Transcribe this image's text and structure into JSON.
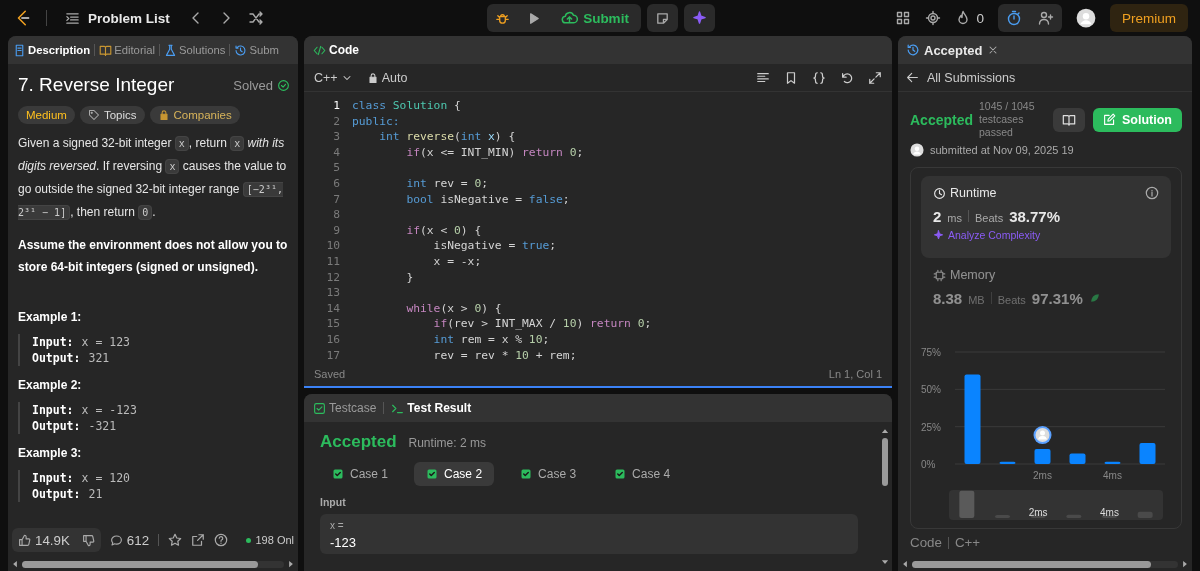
{
  "top_bar": {
    "title": "Problem List",
    "submit": "Submit",
    "streak": "0",
    "premium": "Premium"
  },
  "left_panel": {
    "tabs": [
      {
        "label": "Description",
        "kind": "description",
        "selected": true
      },
      {
        "label": "Editorial",
        "kind": "editorial",
        "selected": false
      },
      {
        "label": "Solutions",
        "kind": "solutions",
        "selected": false
      },
      {
        "label": "Subm",
        "kind": "submissions",
        "selected": false
      }
    ],
    "title": "7. Reverse Integer",
    "status": "Solved",
    "tags": [
      {
        "label": "Medium",
        "kind": "difficulty"
      },
      {
        "label": "Topics",
        "kind": "topics"
      },
      {
        "label": "Companies",
        "kind": "companies"
      }
    ],
    "description": [
      {
        "kind": "text",
        "text": "Given a signed 32-bit integer "
      },
      {
        "kind": "code",
        "text": "x"
      },
      {
        "kind": "text",
        "text": ", return "
      },
      {
        "kind": "code",
        "text": "x"
      },
      {
        "kind": "italic",
        "text": " with its digits reversed"
      },
      {
        "kind": "text",
        "text": ". If reversing "
      },
      {
        "kind": "code",
        "text": "x"
      },
      {
        "kind": "text",
        "text": " causes the value to go outside the signed 32-bit integer range "
      },
      {
        "kind": "code",
        "text": "[−2³¹, 2³¹ − 1]"
      },
      {
        "kind": "text",
        "text": ", then return "
      },
      {
        "kind": "code",
        "text": "0"
      },
      {
        "kind": "text",
        "text": "."
      }
    ],
    "note": "Assume the environment does not allow you to store 64-bit integers (signed or unsigned).",
    "examples": [
      {
        "title": "Example 1:",
        "input_label": "Input:",
        "input": "x = 123",
        "output_label": "Output:",
        "output": "321"
      },
      {
        "title": "Example 2:",
        "input_label": "Input:",
        "input": "x = -123",
        "output_label": "Output:",
        "output": "-321"
      },
      {
        "title": "Example 3:",
        "input_label": "Input:",
        "input": "x = 120",
        "output_label": "Output:",
        "output": "21"
      }
    ],
    "footer": {
      "likes": "14.9K",
      "comments": "612",
      "online": "198 Onl"
    }
  },
  "code_panel": {
    "title": "Code",
    "language": "C++",
    "mode": "Auto",
    "lines": [
      {
        "number": "1",
        "current": true,
        "tokens": [
          {
            "kind": "type",
            "text": "class"
          },
          {
            "kind": "cls",
            "text": " Solution"
          },
          {
            "kind": "plain",
            "text": " {"
          }
        ]
      },
      {
        "number": "2",
        "current": false,
        "tokens": [
          {
            "kind": "type",
            "text": "public:"
          }
        ]
      },
      {
        "number": "3",
        "current": false,
        "tokens": [
          {
            "kind": "type",
            "text": "    int"
          },
          {
            "kind": "fn",
            "text": " reverse"
          },
          {
            "kind": "plain",
            "text": "("
          },
          {
            "kind": "type",
            "text": "int"
          },
          {
            "kind": "var",
            "text": " x"
          },
          {
            "kind": "plain",
            "text": ") {"
          }
        ]
      },
      {
        "number": "4",
        "current": false,
        "tokens": [
          {
            "kind": "ctrl",
            "text": "        if"
          },
          {
            "kind": "plain",
            "text": "(x <= INT_MIN) "
          },
          {
            "kind": "ctrl",
            "text": "return"
          },
          {
            "kind": "num",
            "text": " 0"
          },
          {
            "kind": "plain",
            "text": ";"
          }
        ]
      },
      {
        "number": "5",
        "current": false
      },
      {
        "number": "6",
        "current": false,
        "tokens": [
          {
            "kind": "type",
            "text": "        int"
          },
          {
            "kind": "plain",
            "text": " rev = "
          },
          {
            "kind": "num",
            "text": "0"
          },
          {
            "kind": "plain",
            "text": ";"
          }
        ]
      },
      {
        "number": "7",
        "current": false,
        "tokens": [
          {
            "kind": "type",
            "text": "        bool"
          },
          {
            "kind": "plain",
            "text": " isNegative = "
          },
          {
            "kind": "type",
            "text": "false"
          },
          {
            "kind": "plain",
            "text": ";"
          }
        ]
      },
      {
        "number": "8",
        "current": false
      },
      {
        "number": "9",
        "current": false,
        "tokens": [
          {
            "kind": "ctrl",
            "text": "        if"
          },
          {
            "kind": "plain",
            "text": "(x < "
          },
          {
            "kind": "num",
            "text": "0"
          },
          {
            "kind": "plain",
            "text": ") {"
          }
        ]
      },
      {
        "number": "10",
        "current": false,
        "tokens": [
          {
            "kind": "plain",
            "text": "            isNegative = "
          },
          {
            "kind": "type",
            "text": "true"
          },
          {
            "kind": "plain",
            "text": ";"
          }
        ]
      },
      {
        "number": "11",
        "current": false,
        "tokens": [
          {
            "kind": "plain",
            "text": "            x = -x;"
          }
        ]
      },
      {
        "number": "12",
        "current": false,
        "tokens": [
          {
            "kind": "plain",
            "text": "        }"
          }
        ]
      },
      {
        "number": "13",
        "current": false
      },
      {
        "number": "14",
        "current": false,
        "tokens": [
          {
            "kind": "ctrl",
            "text": "        while"
          },
          {
            "kind": "plain",
            "text": "(x > "
          },
          {
            "kind": "num",
            "text": "0"
          },
          {
            "kind": "plain",
            "text": ") {"
          }
        ]
      },
      {
        "number": "15",
        "current": false,
        "tokens": [
          {
            "kind": "ctrl",
            "text": "            if"
          },
          {
            "kind": "plain",
            "text": "(rev > INT_MAX / "
          },
          {
            "kind": "num",
            "text": "10"
          },
          {
            "kind": "plain",
            "text": ") "
          },
          {
            "kind": "ctrl",
            "text": "return"
          },
          {
            "kind": "num",
            "text": " 0"
          },
          {
            "kind": "plain",
            "text": ";"
          }
        ]
      },
      {
        "number": "16",
        "current": false,
        "tokens": [
          {
            "kind": "type",
            "text": "            int"
          },
          {
            "kind": "plain",
            "text": " rem = x % "
          },
          {
            "kind": "num",
            "text": "10"
          },
          {
            "kind": "plain",
            "text": ";"
          }
        ]
      },
      {
        "number": "17",
        "current": false,
        "tokens": [
          {
            "kind": "plain",
            "text": "            rev = rev * "
          },
          {
            "kind": "num",
            "text": "10"
          },
          {
            "kind": "plain",
            "text": " + rem;"
          }
        ]
      }
    ],
    "status": "Saved",
    "cursor": "Ln 1, Col 1"
  },
  "test_panel": {
    "tabs": [
      {
        "label": "Testcase",
        "kind": "testcase",
        "selected": false
      },
      {
        "label": "Test Result",
        "kind": "result",
        "selected": true
      }
    ],
    "verdict": "Accepted",
    "runtime": "Runtime: 2 ms",
    "cases": [
      {
        "label": "Case 1",
        "passed": true,
        "selected": false
      },
      {
        "label": "Case 2",
        "passed": true,
        "selected": true
      },
      {
        "label": "Case 3",
        "passed": true,
        "selected": false
      },
      {
        "label": "Case 4",
        "passed": true,
        "selected": false
      }
    ],
    "input_label": "Input",
    "variable": "x =",
    "value": "-123"
  },
  "right_panel": {
    "tab": "Accepted",
    "back": "All Submissions",
    "status": "Accepted",
    "passed": "1045 / 1045",
    "passed_label": "testcases passed",
    "submitted": "submitted at Nov 09, 2025 19",
    "solution_button": "Solution",
    "metrics": [
      {
        "kind": "runtime",
        "label": "Runtime",
        "value": "2",
        "unit": "ms",
        "beats_label": "Beats",
        "beats": "38.77%",
        "link": "Analyze Complexity",
        "selected": true
      },
      {
        "kind": "memory",
        "label": "Memory",
        "value": "8.38",
        "unit": "MB",
        "beats_label": "Beats",
        "beats": "97.31%",
        "selected": false
      }
    ],
    "chart_data": {
      "type": "bar",
      "categories": [
        null,
        null,
        "2ms",
        null,
        "4ms",
        null
      ],
      "values": [
        60,
        1.5,
        10,
        7,
        1.5,
        14
      ],
      "ylim": [
        0,
        75
      ],
      "yticks": [
        {
          "value": 0,
          "label": "0%"
        },
        {
          "value": 25,
          "label": "25%"
        },
        {
          "value": 50,
          "label": "50%"
        },
        {
          "value": 75,
          "label": "75%"
        }
      ]
    },
    "overview_labels": [
      "2ms",
      "4ms"
    ],
    "footer_tabs": [
      "Code",
      "C++"
    ]
  }
}
